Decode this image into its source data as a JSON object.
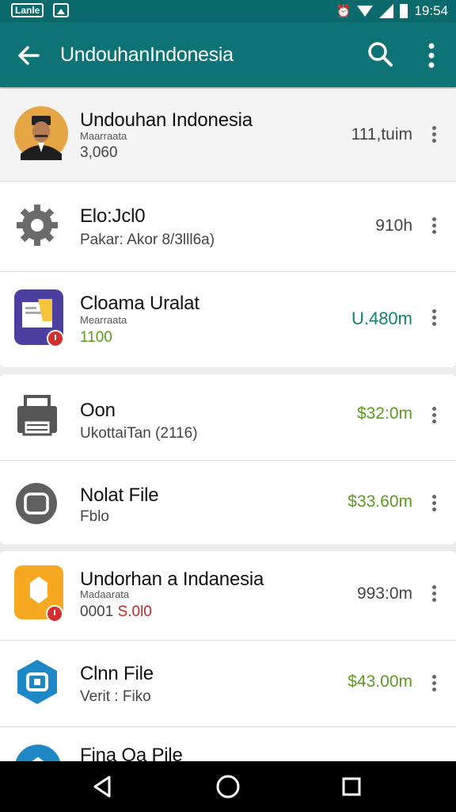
{
  "status_bar": {
    "badge": "Lanle",
    "time": "19:54",
    "icons": [
      "photo-icon",
      "alarm-icon",
      "wifi-icon",
      "signal-icon",
      "battery-icon"
    ]
  },
  "app_bar": {
    "title": "UndouhanIndonesia",
    "icons": [
      "back-arrow-icon",
      "search-icon",
      "overflow-menu-icon"
    ]
  },
  "items": [
    {
      "name": "Undouhan Indonesia",
      "sub": "Maarraata",
      "meta": "3,060",
      "size": "111,tuim",
      "icon": "avatar"
    },
    {
      "name": "Elo:Jcl0",
      "sub": "",
      "meta": "Pakar: Akor 8/3lll6a)",
      "size": "910h",
      "icon": "gear-icon"
    },
    {
      "name": "Cloama Uralat",
      "sub": "Mearraata",
      "meta": "1100",
      "size": "U.480m",
      "icon": "document-app-icon"
    },
    {
      "name": "Oon",
      "sub": "",
      "meta": "UkottaiTan (2116)",
      "size": "$32:0m",
      "icon": "printer-icon"
    },
    {
      "name": "Nolat File",
      "sub": "",
      "meta": "Fblo",
      "size": "$33.60m",
      "icon": "tv-icon"
    },
    {
      "name": "Undorhan a Indanesia",
      "sub": "Madaarata",
      "meta_prefix": "0001",
      "meta_accent": "S.0l0",
      "size": "993:0m",
      "icon": "home-app-icon"
    },
    {
      "name": "Clnn File",
      "sub": "",
      "meta": "Verit : Fiko",
      "size": "$43.00m",
      "icon": "hexagon-app-icon"
    },
    {
      "name": "Fina Oa Pile",
      "sub": "",
      "meta": "",
      "size": "",
      "icon": "blue-app-icon"
    }
  ],
  "colors": {
    "primary": "#0d7374",
    "status_bar": "#0b6a6b",
    "green_size": "#5a9a1e",
    "teal_size": "#11806f",
    "accent_red": "#c62828"
  },
  "navigation_bar": [
    "back-triangle-icon",
    "home-circle-icon",
    "recents-square-icon"
  ]
}
